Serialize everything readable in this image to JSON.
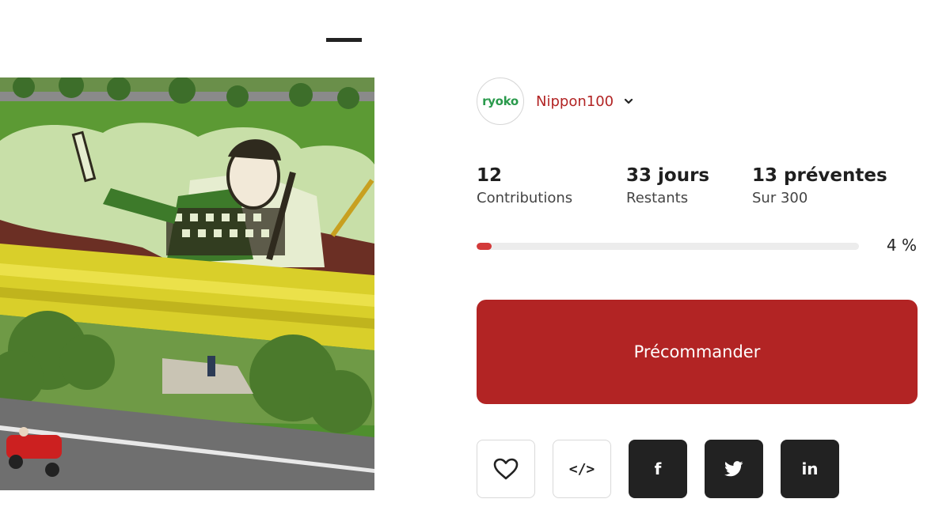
{
  "creator": {
    "logo_text": "ryoko",
    "name": "Nippon100"
  },
  "stats": [
    {
      "value": "12",
      "label": "Contributions"
    },
    {
      "value": "33 jours",
      "label": "Restants"
    },
    {
      "value": "13 préventes",
      "label": "Sur 300"
    }
  ],
  "progress": {
    "percent": 4,
    "label": "4 %"
  },
  "cta": {
    "label": "Précommander"
  },
  "actions": {
    "like_icon": "heart-icon",
    "embed_label": "</>",
    "facebook_label": "f",
    "linkedin_label": "in"
  },
  "colors": {
    "brand": "#b22424",
    "progress": "#d33a3a",
    "logo_green": "#2a9a4c",
    "dark_button": "#222222"
  }
}
